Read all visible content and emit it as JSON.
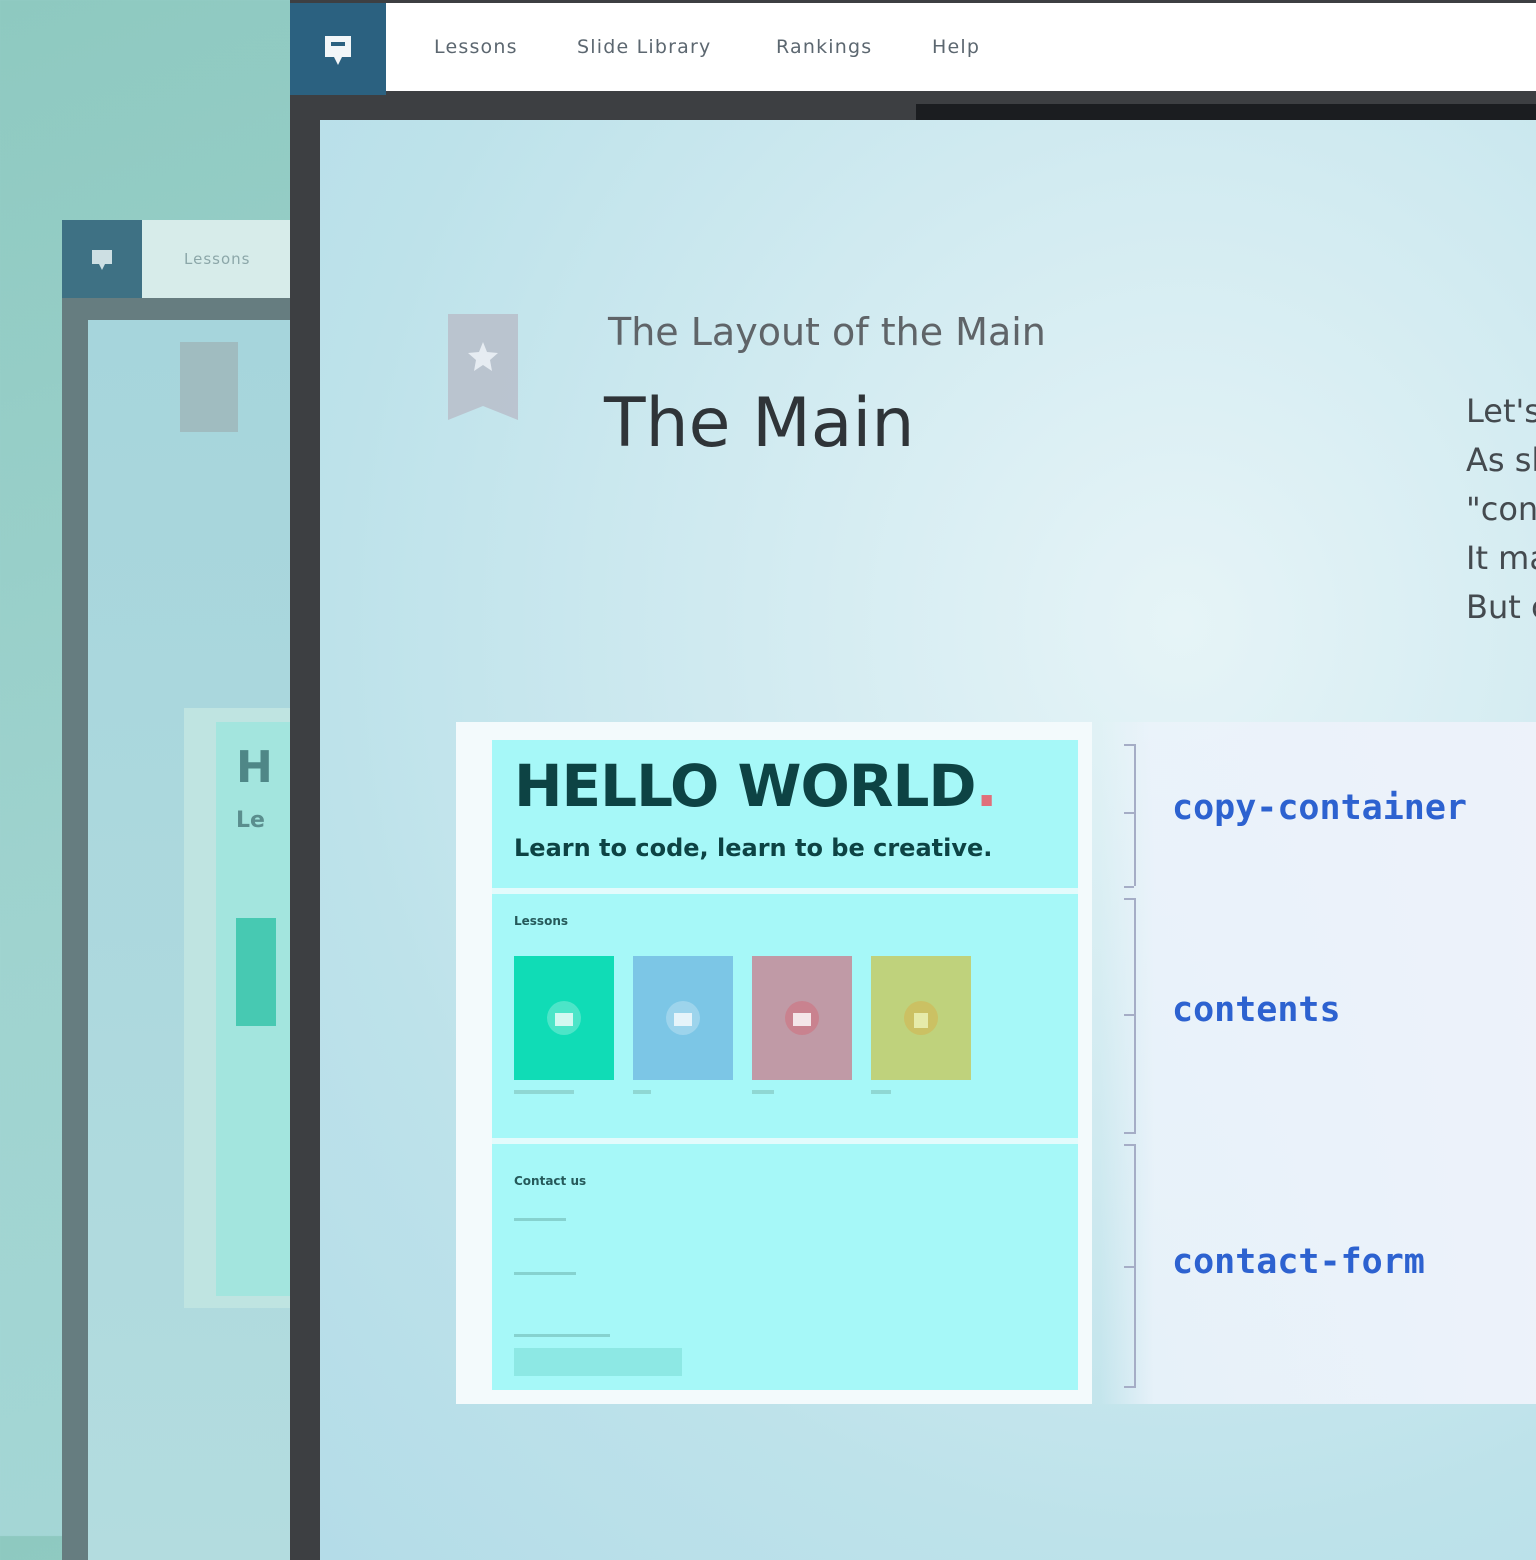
{
  "background_window": {
    "nav_label": "Lessons",
    "preview_letters": [
      "H",
      "Le"
    ]
  },
  "nav": {
    "items": [
      "Lessons",
      "Slide Library",
      "Rankings",
      "Help"
    ]
  },
  "slide": {
    "subtitle": "The Layout of the Main",
    "title": "The Main",
    "right_text_lines": [
      "Let's",
      "As sl",
      "\"con",
      "It ma",
      "But c"
    ]
  },
  "preview": {
    "heading": "HELLO WORLD",
    "heading_dot": ".",
    "tagline": "Learn to code, learn to be creative.",
    "lessons_heading": "Lessons",
    "contact_heading": "Contact us"
  },
  "annotations": {
    "copy_container": "copy-container",
    "contents": "contents",
    "contact_form": "contact-form"
  },
  "colors": {
    "logo_bg": "#2b6180",
    "preview_bg": "#a6f8f8",
    "annotation": "#2d62d0",
    "tile_colors": [
      "#10dcb6",
      "#7cc6e6",
      "#c09aa6",
      "#bfd27c"
    ]
  },
  "icons": [
    "logo-icon",
    "bookmark-star-icon",
    "lesson-tile-icon"
  ]
}
